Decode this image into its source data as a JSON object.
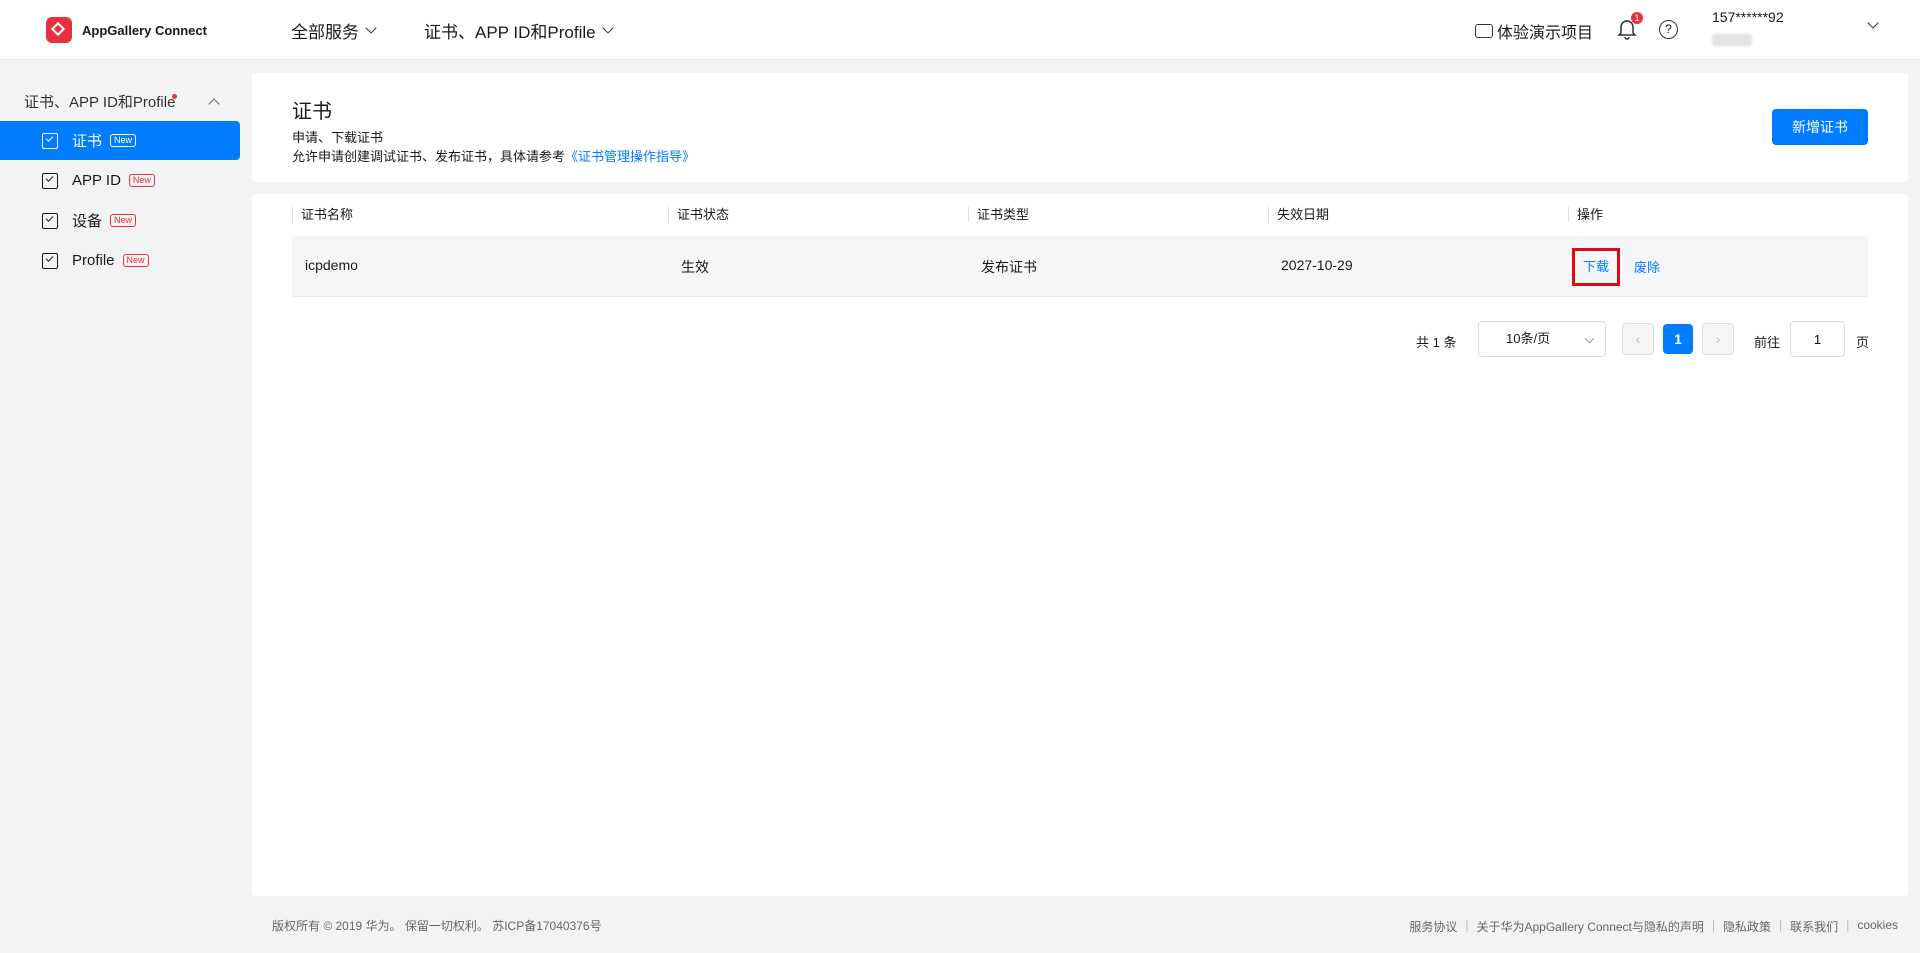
{
  "header": {
    "logo_text": "AppGallery Connect",
    "nav": [
      "全部服务",
      "证书、APP ID和Profile"
    ],
    "demo_label": "体验演示项目",
    "notification_count": "1",
    "help_symbol": "?",
    "user_name": "157******92"
  },
  "sidebar": {
    "title": "证书、APP ID和Profile",
    "items": [
      {
        "label": "证书",
        "tag": "New",
        "active": true
      },
      {
        "label": "APP ID",
        "tag": "New",
        "active": false
      },
      {
        "label": "设备",
        "tag": "New",
        "active": false
      },
      {
        "label": "Profile",
        "tag": "New",
        "active": false
      }
    ]
  },
  "page": {
    "title": "证书",
    "desc1": "申请、下载证书",
    "desc2_prefix": "允许申请创建调试证书、发布证书，具体请参考",
    "desc2_link": "《证书管理操作指导》",
    "new_button": "新增证书"
  },
  "table": {
    "columns": [
      "证书名称",
      "证书状态",
      "证书类型",
      "失效日期",
      "操作"
    ],
    "rows": [
      {
        "name": "icpdemo",
        "status": "生效",
        "type": "发布证书",
        "expiry": "2027-10-29",
        "actions": [
          "下载",
          "废除"
        ]
      }
    ]
  },
  "pagination": {
    "total": "共 1 条",
    "page_size": "10条/页",
    "prev": "‹",
    "current": "1",
    "next": "›",
    "goto_label": "前往",
    "goto_value": "1",
    "goto_suffix": "页"
  },
  "footer": {
    "copyright": "版权所有 © 2019 华为。 保留一切权利。 苏ICP备17040376号",
    "links": [
      "服务协议",
      "关于华为AppGallery Connect与隐私的声明",
      "隐私政策",
      "联系我们",
      "cookies"
    ]
  },
  "colors": {
    "accent": "#007dff",
    "highlight_box": "#e30613",
    "badge": "#e8313e"
  }
}
